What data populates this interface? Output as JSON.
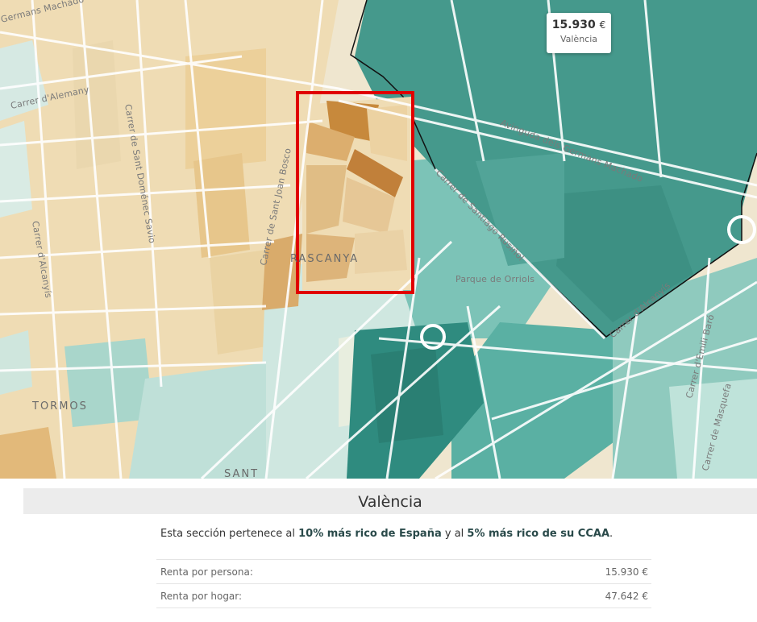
{
  "map": {
    "area_labels": [
      "RASCANYA",
      "TORMOS",
      "SANT"
    ],
    "street_labels": [
      "Germans Machado",
      "Carrer d'Alemany",
      "Carrer de Sant Doménec Savio",
      "Carrer d'Alcanyís",
      "Carrer de Sant Joan Bosco",
      "Avinguda dels Germans Machado",
      "Carrer de Santiago Rusiñol",
      "Parque de Orriols",
      "Carrer d'Alcanyís",
      "Carrer d'Emili Baró",
      "Carrer de Masquefa"
    ],
    "highlight_color": "#e00000"
  },
  "tooltip": {
    "value": "15.930",
    "currency": "€",
    "city": "València"
  },
  "panel": {
    "title": "València",
    "desc_prefix": "Esta sección pertenece al ",
    "desc_bold1": "10% más rico de España",
    "desc_mid": " y al ",
    "desc_bold2": "5% más rico de su CCAA",
    "desc_suffix": ".",
    "stats": [
      {
        "label": "Renta por persona:",
        "value": "15.930 €"
      },
      {
        "label": "Renta por hogar:",
        "value": "47.642 €"
      }
    ]
  }
}
